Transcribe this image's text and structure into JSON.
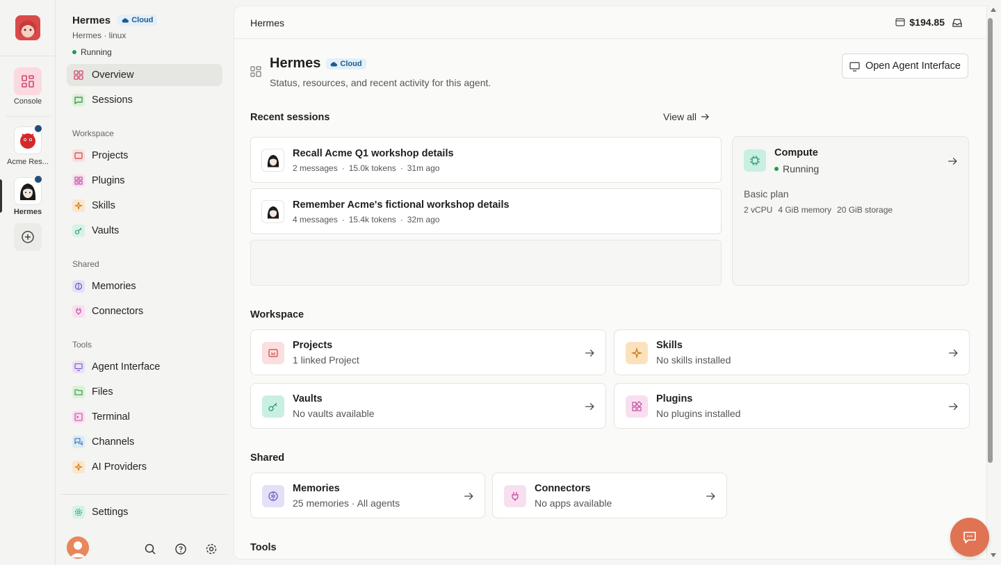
{
  "rail": {
    "console_label": "Console",
    "agents": [
      {
        "label": "Acme Res...",
        "icon": "red-blob-avatar"
      },
      {
        "label": "Hermes",
        "icon": "anime-avatar"
      }
    ]
  },
  "sidebar": {
    "agent_name": "Hermes",
    "badge": "Cloud",
    "subtitle": "Hermes · linux",
    "status": "Running",
    "overview": "Overview",
    "sessions": "Sessions",
    "workspace_heading": "Workspace",
    "workspace_items": [
      "Projects",
      "Plugins",
      "Skills",
      "Vaults"
    ],
    "shared_heading": "Shared",
    "shared_items": [
      "Memories",
      "Connectors"
    ],
    "tools_heading": "Tools",
    "tools_items": [
      "Agent Interface",
      "Files",
      "Terminal",
      "Channels",
      "AI Providers"
    ],
    "settings": "Settings"
  },
  "topbar": {
    "breadcrumb": "Hermes",
    "balance": "$194.85"
  },
  "header": {
    "title": "Hermes",
    "badge": "Cloud",
    "subtitle": "Status, resources, and recent activity for this agent.",
    "open_button": "Open Agent Interface"
  },
  "recent": {
    "heading": "Recent sessions",
    "view_all": "View all",
    "sessions": [
      {
        "title": "Recall Acme Q1 workshop details",
        "messages": "2 messages",
        "tokens": "15.0k tokens",
        "time": "31m ago"
      },
      {
        "title": "Remember Acme's fictional workshop details",
        "messages": "4 messages",
        "tokens": "15.4k tokens",
        "time": "32m ago"
      }
    ],
    "separator": "·"
  },
  "compute": {
    "title": "Compute",
    "status": "Running",
    "plan": "Basic plan",
    "cpu": "2 vCPU",
    "memory": "4 GiB memory",
    "storage": "20 GiB storage"
  },
  "workspace": {
    "heading": "Workspace",
    "cards": [
      {
        "title": "Projects",
        "sub": "1 linked Project"
      },
      {
        "title": "Skills",
        "sub": "No skills installed"
      },
      {
        "title": "Vaults",
        "sub": "No vaults available"
      },
      {
        "title": "Plugins",
        "sub": "No plugins installed"
      }
    ]
  },
  "shared": {
    "heading": "Shared",
    "cards": [
      {
        "title": "Memories",
        "sub": "25 memories · All agents"
      },
      {
        "title": "Connectors",
        "sub": "No apps available"
      }
    ]
  },
  "tools": {
    "heading": "Tools"
  },
  "colors": {
    "accent_coral": "#e07353",
    "status_green": "#1f9d55",
    "cloud_badge_bg": "#e3effa"
  }
}
